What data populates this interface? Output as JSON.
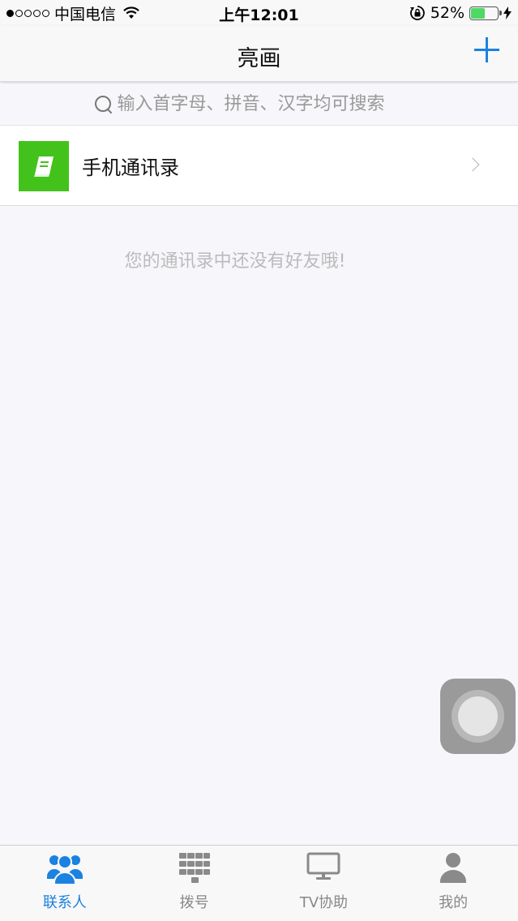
{
  "status_bar": {
    "signal_dots": 5,
    "signal_filled": 1,
    "carrier": "中国电信",
    "time": "上午12:01",
    "battery_percent": "52%",
    "battery_level": 0.52,
    "battery_color": "#4cd964"
  },
  "nav": {
    "title": "亮画"
  },
  "search": {
    "placeholder": "输入首字母、拼音、汉字均可搜索"
  },
  "list": {
    "phone_contacts_label": "手机通讯录",
    "icon_color": "#43c21c"
  },
  "empty_message": "您的通讯录中还没有好友哦!",
  "tabs": [
    {
      "label": "联系人",
      "active": true
    },
    {
      "label": "拨号",
      "active": false
    },
    {
      "label": "TV协助",
      "active": false
    },
    {
      "label": "我的",
      "active": false
    }
  ],
  "colors": {
    "accent": "#1a82e0",
    "inactive": "#8a8a8a"
  }
}
